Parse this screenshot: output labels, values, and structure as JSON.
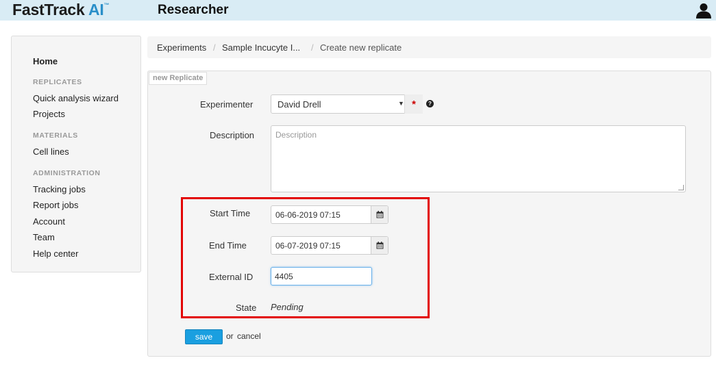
{
  "header": {
    "brand_main": "FastTrack ",
    "brand_ai": "AI",
    "brand_tm": "™",
    "role": "Researcher",
    "user_icon": "user-icon"
  },
  "sidebar": {
    "home": "Home",
    "sections": [
      {
        "heading": "REPLICATES",
        "items": [
          "Quick analysis wizard",
          "Projects"
        ]
      },
      {
        "heading": "MATERIALS",
        "items": [
          "Cell lines"
        ]
      },
      {
        "heading": "ADMINISTRATION",
        "items": [
          "Tracking jobs",
          "Report jobs",
          "Account",
          "Team",
          "Help center"
        ]
      }
    ]
  },
  "breadcrumb": {
    "items": [
      "Experiments",
      "Sample Incucyte I...",
      "Create new replicate"
    ],
    "separator": "/"
  },
  "form": {
    "legend": "new Replicate",
    "experimenter": {
      "label": "Experimenter",
      "value": "David Drell",
      "required_mark": "*",
      "help": "?"
    },
    "description": {
      "label": "Description",
      "placeholder": "Description"
    },
    "start_time": {
      "label": "Start Time",
      "value": "06-06-2019 07:15"
    },
    "end_time": {
      "label": "End Time",
      "value": "06-07-2019 07:15"
    },
    "external_id": {
      "label": "External ID",
      "value": "4405"
    },
    "state": {
      "label": "State",
      "value": "Pending"
    },
    "save_label": "save",
    "or_text": "or",
    "cancel_label": "cancel"
  },
  "colors": {
    "topbar": "#d9ecf5",
    "brand_accent": "#2a8fc9",
    "highlight": "#e30000",
    "save_button": "#1a9fe0"
  }
}
